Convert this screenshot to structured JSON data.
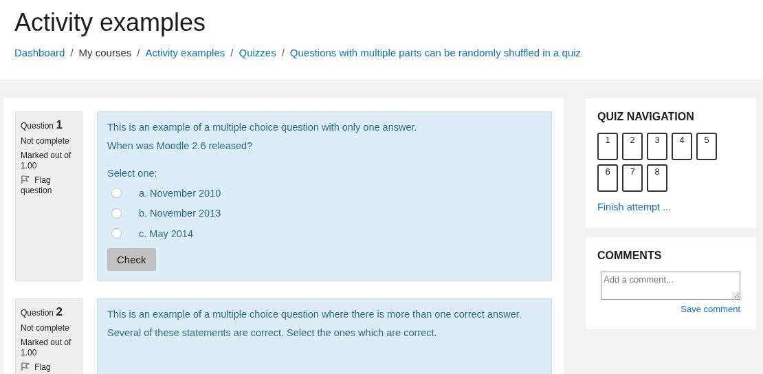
{
  "page_title": "Activity examples",
  "breadcrumb": [
    {
      "label": "Dashboard",
      "link": true
    },
    {
      "separator": "/",
      "label": "My courses",
      "link": false
    },
    {
      "separator": "/",
      "label": "Activity examples",
      "link": true
    },
    {
      "separator": "/",
      "label": "Quizzes",
      "link": true
    },
    {
      "separator": "/",
      "label": "Questions with multiple parts can be randomly shuffled in a quiz",
      "link": true
    }
  ],
  "questions": [
    {
      "label": "Question",
      "number": "1",
      "status": "Not complete",
      "marks": "Marked out of 1.00",
      "flag": "Flag question",
      "paragraphs": [
        "This is an example of a multiple choice question with only one answer.",
        "When was Moodle 2.6 released?"
      ],
      "prompt": "Select one:",
      "choices": [
        {
          "label": "a. November 2010",
          "selected": false
        },
        {
          "label": "b. November 2013",
          "selected": false
        },
        {
          "label": "c. May 2014",
          "selected": false
        }
      ],
      "button": "Check"
    },
    {
      "label": "Question",
      "number": "2",
      "status": "Not complete",
      "marks": "Marked out of 1.00",
      "flag": "Flag",
      "paragraphs": [
        "This is an example of a multiple choice question where there is more than one correct answer.",
        "Several of these statements are correct. Select the ones which are correct."
      ]
    }
  ],
  "quiz_navigation": {
    "title": "QUIZ NAVIGATION",
    "buttons": [
      "1",
      "2",
      "3",
      "4",
      "5",
      "6",
      "7",
      "8"
    ],
    "finish": "Finish attempt ..."
  },
  "comments": {
    "title": "COMMENTS",
    "placeholder": "Add a comment...",
    "save": "Save comment"
  }
}
